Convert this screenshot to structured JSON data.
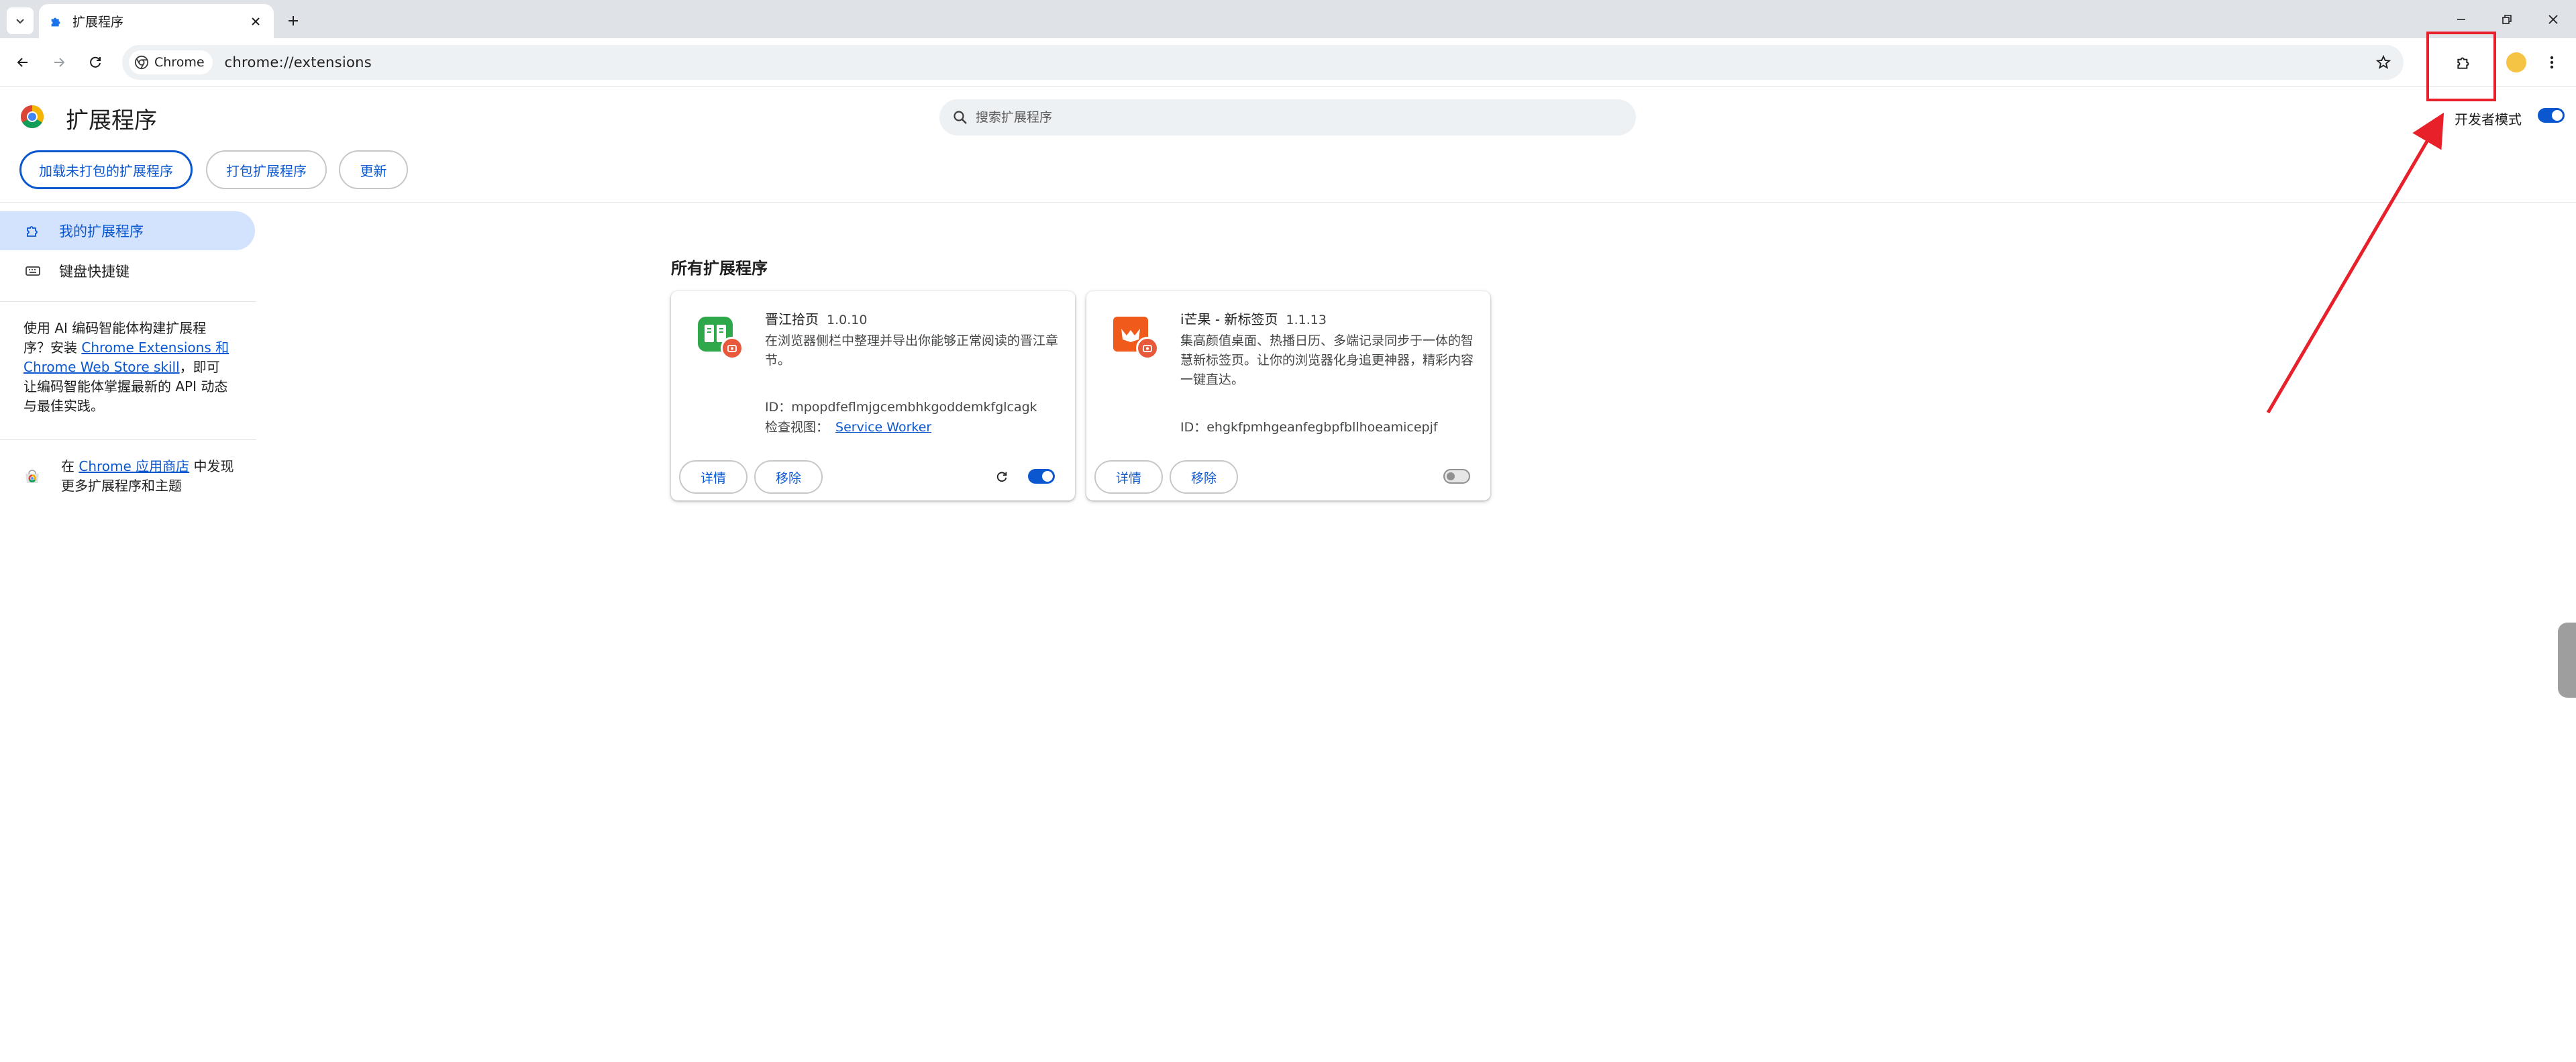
{
  "browser": {
    "tab": {
      "title": "扩展程序"
    },
    "chip_label": "Chrome",
    "url": "chrome://extensions"
  },
  "header": {
    "title": "扩展程序",
    "search_placeholder": "搜索扩展程序",
    "dev_mode_label": "开发者模式",
    "dev_mode_enabled": true
  },
  "actions": {
    "load_unpacked": "加载未打包的扩展程序",
    "pack": "打包扩展程序",
    "update": "更新"
  },
  "sidebar": {
    "items": [
      {
        "label": "我的扩展程序",
        "active": true
      },
      {
        "label": "键盘快捷键",
        "active": false
      }
    ],
    "note_prefix": "使用 AI 编码智能体构建扩展程序？安装 ",
    "note_link": "Chrome Extensions 和 Chrome Web Store skill",
    "note_suffix": "，即可让编码智能体掌握最新的 API 动态与最佳实践。",
    "store_prefix": "在 ",
    "store_link": "Chrome 应用商店",
    "store_suffix": " 中发现更多扩展程序和主题"
  },
  "main": {
    "section_title": "所有扩展程序",
    "extensions": [
      {
        "name": "晋江拾页",
        "version": "1.0.10",
        "description": "在浏览器侧栏中整理并导出你能够正常阅读的晋江章节。",
        "id_label": "ID：",
        "id": "mpopdfeflmjgcembhkgoddemkfglcagk",
        "inspect_label": "检查视图：",
        "inspect_link": "Service Worker",
        "details_label": "详情",
        "remove_label": "移除",
        "enabled": true,
        "icon_color": "#2ea84a"
      },
      {
        "name": "i芒果 - 新标签页",
        "version": "1.1.13",
        "description": "集高颜值桌面、热播日历、多端记录同步于一体的智慧新标签页。让你的浏览器化身追更神器，精彩内容一键直达。",
        "id_label": "ID：",
        "id": "ehgkfpmhgeanfegbpfbllhoeamicepjf",
        "details_label": "详情",
        "remove_label": "移除",
        "enabled": false,
        "icon_color": "#f05a1a"
      }
    ]
  },
  "colors": {
    "accent": "#0b57d0",
    "active_bg": "#d3e3fd",
    "annotation": "#e8202a"
  }
}
